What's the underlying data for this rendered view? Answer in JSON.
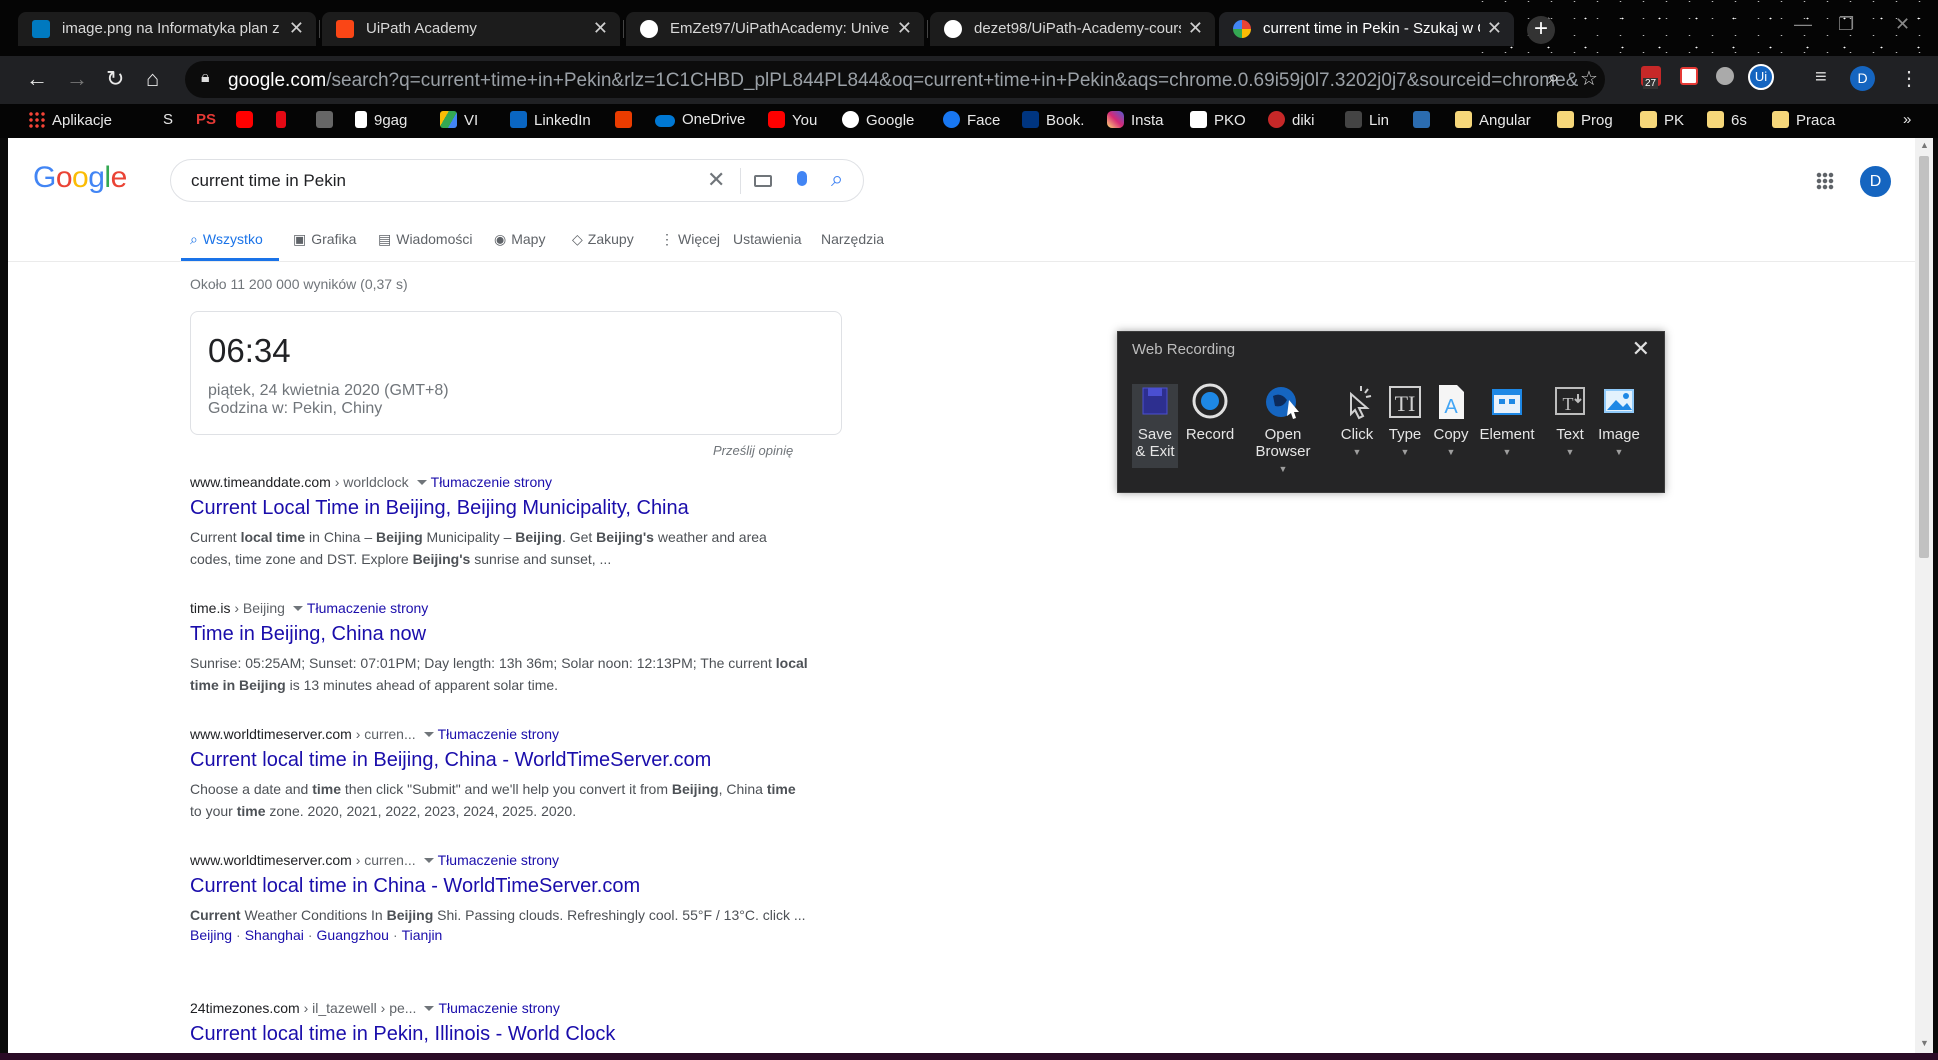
{
  "browser": {
    "tabs": [
      {
        "title": "image.png na Informatyka plan z",
        "active": false
      },
      {
        "title": "UiPath Academy",
        "active": false
      },
      {
        "title": "EmZet97/UiPathAcademy: Univer",
        "active": false
      },
      {
        "title": "dezet98/UiPath-Academy-course",
        "active": false
      },
      {
        "title": "current time in Pekin - Szukaj w G",
        "active": true
      }
    ],
    "new_tab": "+",
    "url_host": "google.com",
    "url_rest": "/search?q=current+time+in+Pekin&rlz=1C1CHBD_plPL844PL844&oq=current+time+in+Pekin&aqs=chrome.0.69i59j0l7.3202j0j7&sourceid=chrome&ie=U...",
    "profile_initial": "D",
    "badge_count": "27",
    "bookmarks": [
      "Aplikacje",
      "S",
      "PS",
      "",
      "",
      "",
      "9gag",
      "VI",
      "LinkedIn",
      "",
      "OneDrive",
      "You",
      "Google",
      "Face",
      "Book.",
      "Insta",
      "PKO",
      "diki",
      "Lin",
      "",
      "Angular",
      "Prog",
      "PK",
      "6s",
      "Praca"
    ],
    "bookmarks_more": "»"
  },
  "google": {
    "logo": "Google",
    "query": "current time in Pekin",
    "nav": [
      {
        "label": "Wszystko",
        "active": true
      },
      {
        "label": "Grafika",
        "active": false
      },
      {
        "label": "Wiadomości",
        "active": false
      },
      {
        "label": "Mapy",
        "active": false
      },
      {
        "label": "Zakupy",
        "active": false
      },
      {
        "label": "Więcej",
        "active": false
      },
      {
        "label": "Ustawienia",
        "active": false
      },
      {
        "label": "Narzędzia",
        "active": false
      }
    ],
    "stats": "Około 11 200 000 wyników (0,37 s)",
    "time_card": {
      "time": "06:34",
      "date": "piątek, 24 kwietnia 2020 (GMT+8)",
      "location": "Godzina w: Pekin, Chiny"
    },
    "feedback": "Prześlij opinię",
    "translate_label": "Tłumaczenie strony",
    "results": [
      {
        "host": "www.timeanddate.com",
        "crumb": " › worldclock",
        "title": "Current Local Time in Beijing, Beijing Municipality, China",
        "snippet_html": "Current <b>local time</b> in China – <b>Beijing</b> Municipality – <b>Beijing</b>. Get <b>Beijing's</b> weather and area codes, time zone and DST. Explore <b>Beijing's</b> sunrise and sunset, ..."
      },
      {
        "host": "time.is",
        "crumb": " › Beijing",
        "title": "Time in Beijing, China now",
        "snippet_html": "Sunrise: 05:25AM; Sunset: 07:01PM; Day length: 13h 36m; Solar noon: 12:13PM; The current <b>local time in Beijing</b> is 13 minutes ahead of apparent solar time."
      },
      {
        "host": "www.worldtimeserver.com",
        "crumb": " › curren...",
        "title": "Current local time in Beijing, China - WorldTimeServer.com",
        "snippet_html": "Choose a date and <b>time</b> then click \"Submit\" and we'll help you convert it from <b>Beijing</b>, China <b>time</b> to your <b>time</b> zone. 2020, 2021, 2022, 2023, 2024, 2025. 2020."
      },
      {
        "host": "www.worldtimeserver.com",
        "crumb": " › curren...",
        "title": "Current local time in China - WorldTimeServer.com",
        "snippet_html": "<b>Current</b> Weather Conditions In <b>Beijing</b> Shi. Passing clouds. Refreshingly cool. 55°F / 13°C. click ...",
        "sitelinks": [
          "Beijing",
          "Shanghai",
          "Guangzhou",
          "Tianjin"
        ]
      },
      {
        "host": "24timezones.com",
        "crumb": " › il_tazewell › pe...",
        "title": "Current local time in Pekin, Illinois - World Clock"
      }
    ],
    "avatar_initial": "D"
  },
  "web_recording": {
    "title": "Web Recording",
    "buttons": [
      {
        "label": "Save\n& Exit",
        "icon": "save-icon"
      },
      {
        "label": "Record",
        "icon": "record-icon"
      },
      {
        "label": "Open\nBrowser",
        "icon": "globe-cursor-icon"
      },
      {
        "label": "Click",
        "icon": "click-icon"
      },
      {
        "label": "Type",
        "icon": "type-icon"
      },
      {
        "label": "Copy",
        "icon": "copy-icon"
      },
      {
        "label": "Element",
        "icon": "element-icon"
      },
      {
        "label": "Text",
        "icon": "text-icon"
      },
      {
        "label": "Image",
        "icon": "image-icon"
      }
    ]
  },
  "colors": {
    "link": "#1a0dab",
    "accent": "#1a73e8",
    "panel_bg": "#252526"
  }
}
